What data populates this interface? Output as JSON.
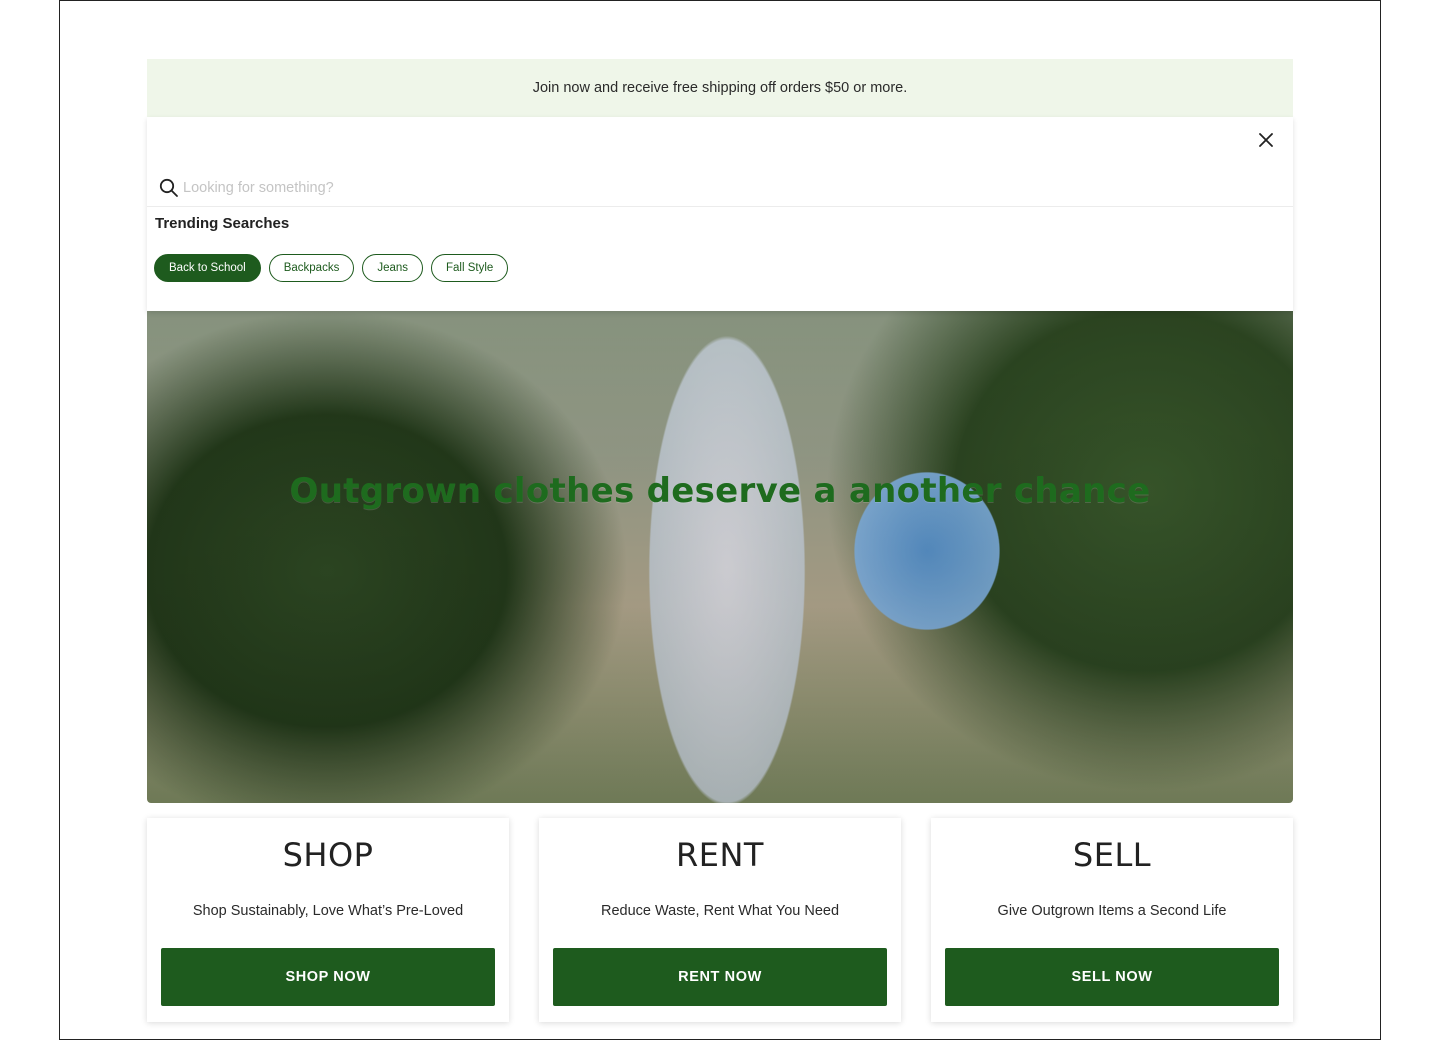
{
  "promo": {
    "text": "Join now and receive free shipping off orders $50 or more."
  },
  "search": {
    "placeholder": "Looking for something?",
    "close_icon": "close-icon",
    "search_icon": "search-icon",
    "trending_title": "Trending Searches",
    "trending": [
      {
        "label": "Back to School",
        "active": true
      },
      {
        "label": "Backpacks",
        "active": false
      },
      {
        "label": "Jeans",
        "active": false
      },
      {
        "label": "Fall Style",
        "active": false
      }
    ]
  },
  "hero": {
    "heading": "Outgrown clothes deserve a another chance"
  },
  "cards": [
    {
      "title": "SHOP",
      "description": "Shop Sustainably, Love What’s Pre-Loved",
      "button": "SHOP NOW"
    },
    {
      "title": "RENT",
      "description": "Reduce Waste, Rent What You Need",
      "button": "RENT NOW"
    },
    {
      "title": "SELL",
      "description": "Give Outgrown Items a Second Life",
      "button": "SELL NOW"
    }
  ],
  "colors": {
    "brand_green": "#1e5b1e",
    "promo_bg": "#eff6e9"
  }
}
